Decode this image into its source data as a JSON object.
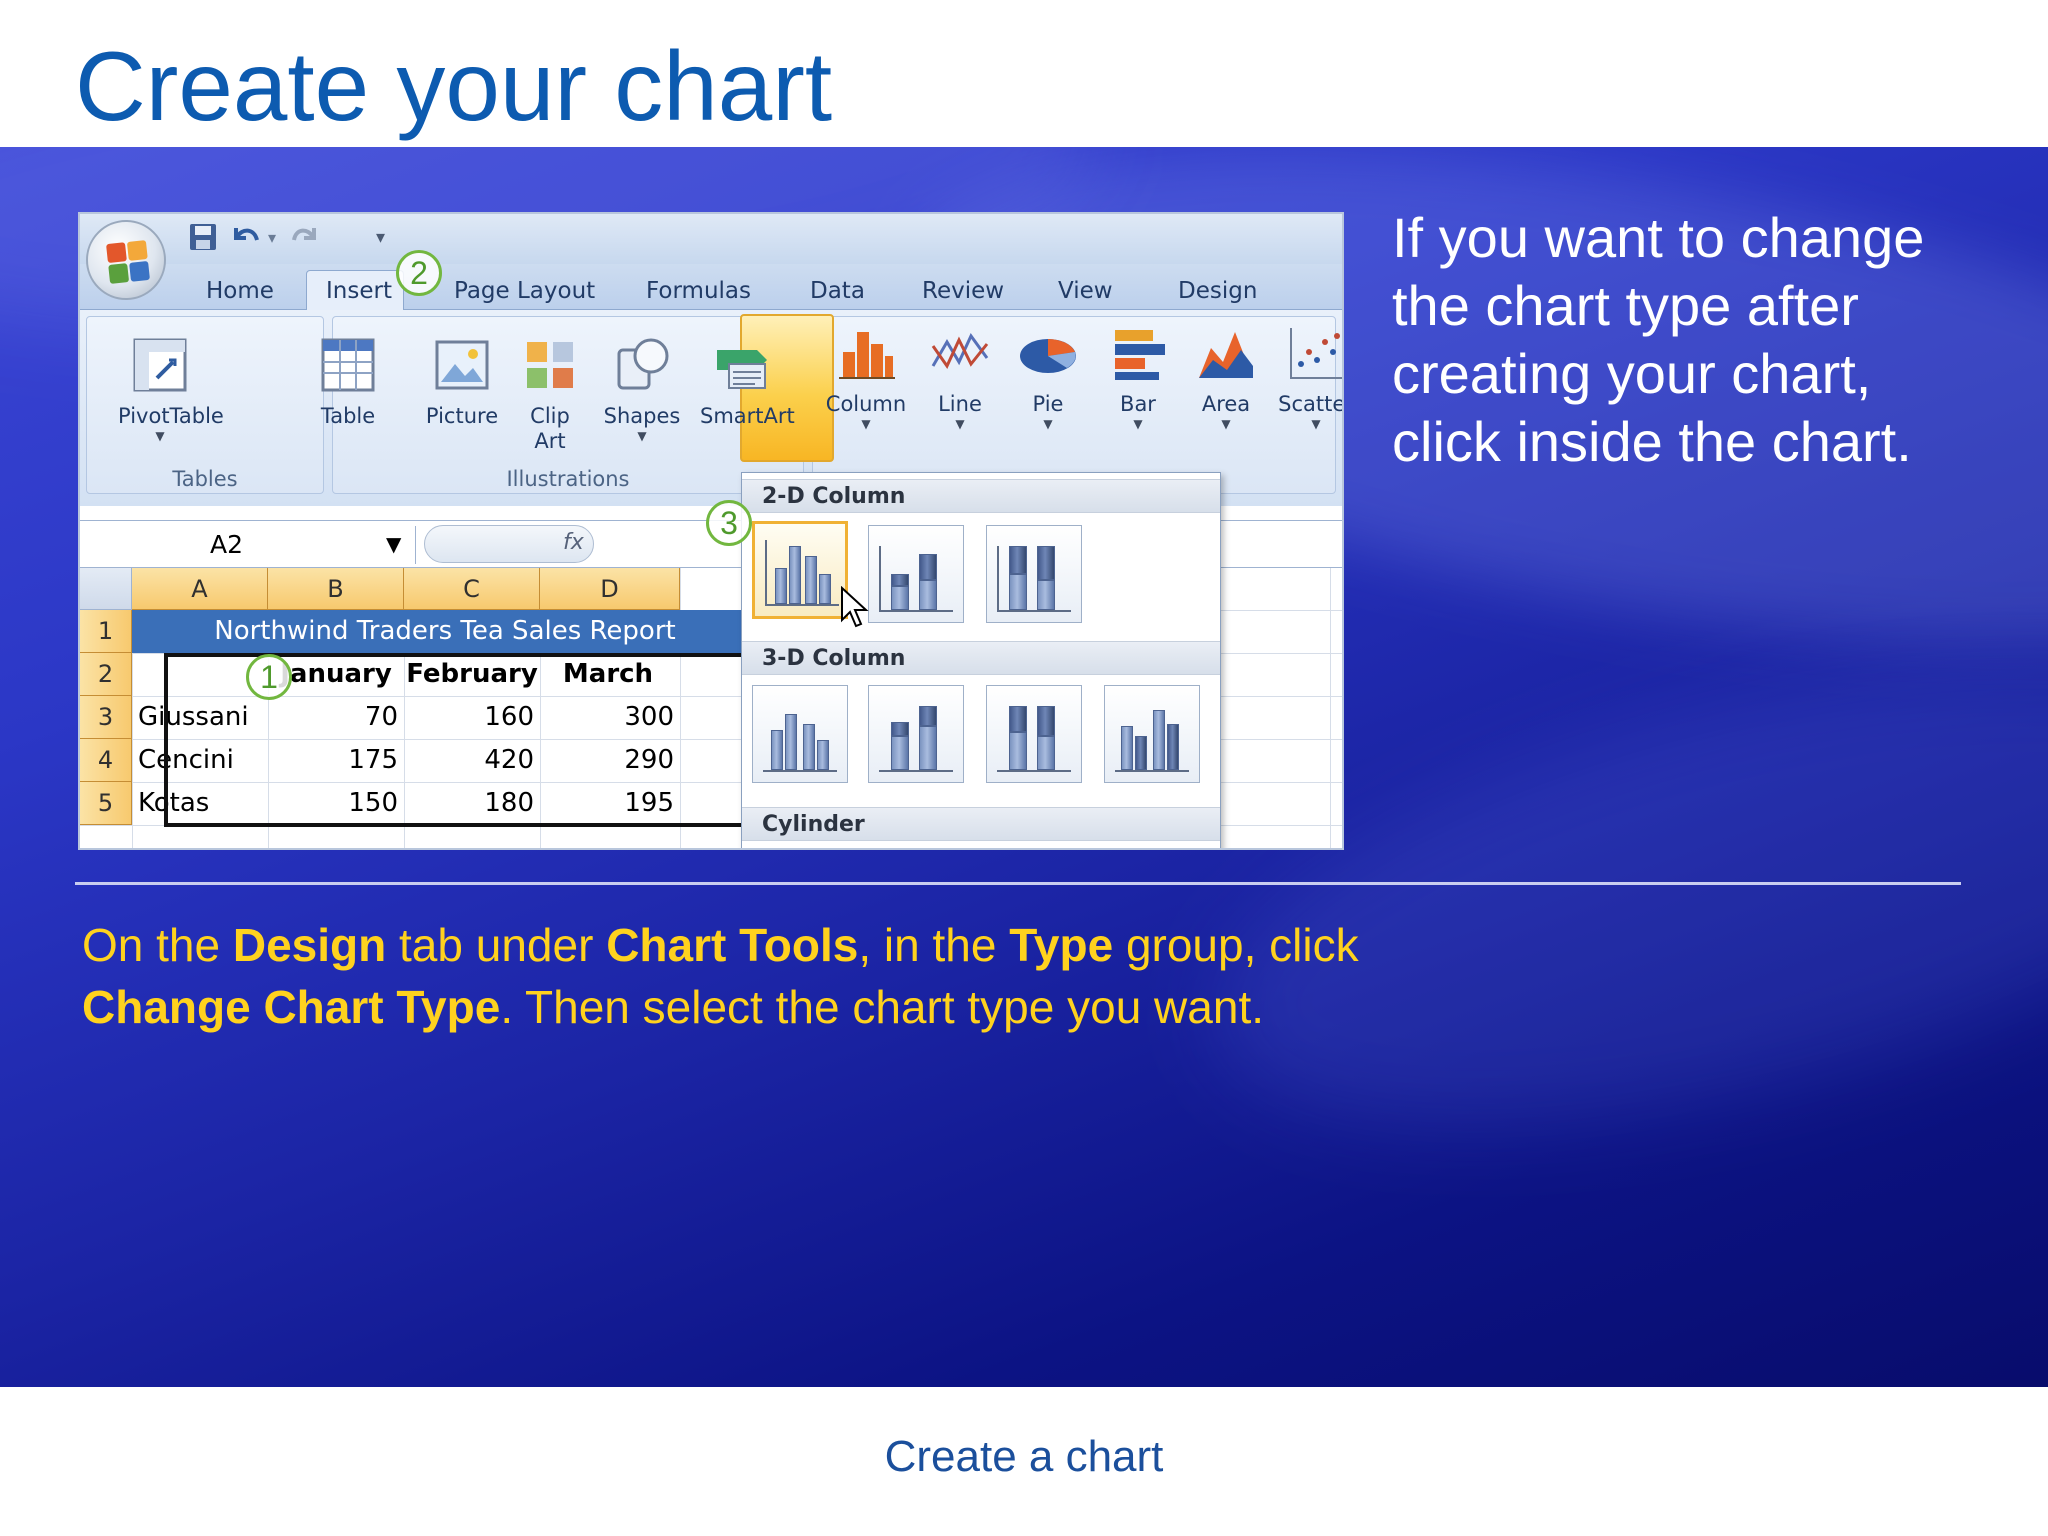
{
  "slide": {
    "title": "Create your chart",
    "side_text": "If you want to change the chart type after creating your chart, click inside the chart.",
    "instruction": {
      "p1": "On the ",
      "b1": "Design",
      "p2": " tab under ",
      "b2": "Chart Tools",
      "p3": ", in the ",
      "b3": "Type",
      "p4": " group, click ",
      "b4": "Change Chart Type",
      "p5": ". Then select the chart type you want."
    },
    "footer": "Create a chart",
    "colors": {
      "title": "#0d5bb0",
      "band": "#2b37c6",
      "instruction": "#ffd21e",
      "callout": "#72b73f"
    }
  },
  "excel": {
    "quick_access": {
      "save_icon": "save-icon",
      "undo_icon": "undo-icon",
      "redo_icon": "redo-icon",
      "customize_icon": "customize-arrow-icon"
    },
    "tabs": [
      "Home",
      "Insert",
      "Page Layout",
      "Formulas",
      "Data",
      "Review",
      "View",
      "Design"
    ],
    "ribbon": {
      "groups": [
        "Tables",
        "Illustrations"
      ],
      "tables": [
        "PivotTable",
        "Table"
      ],
      "illustrations": [
        "Picture",
        "Clip Art",
        "Shapes",
        "SmartArt"
      ],
      "charts": [
        "Column",
        "Line",
        "Pie",
        "Bar",
        "Area",
        "Scatter"
      ]
    },
    "name_box": "A2",
    "fx": "fx",
    "columns": [
      "A",
      "B",
      "C",
      "D"
    ],
    "rows": [
      "1",
      "2",
      "3",
      "4",
      "5"
    ],
    "report_title": "Northwind Traders Tea Sales Report",
    "header_row": [
      "January",
      "February",
      "March"
    ],
    "data": [
      {
        "name": "Giussani",
        "values": [
          "70",
          "160",
          "300"
        ]
      },
      {
        "name": "Cencini",
        "values": [
          "175",
          "420",
          "290"
        ]
      },
      {
        "name": "Kotas",
        "values": [
          "150",
          "180",
          "195"
        ]
      }
    ],
    "dropdown": {
      "section_2d": "2-D Column",
      "section_3d": "3-D Column",
      "section_cylinder": "Cylinder"
    }
  },
  "callouts": [
    "1",
    "2",
    "3"
  ]
}
